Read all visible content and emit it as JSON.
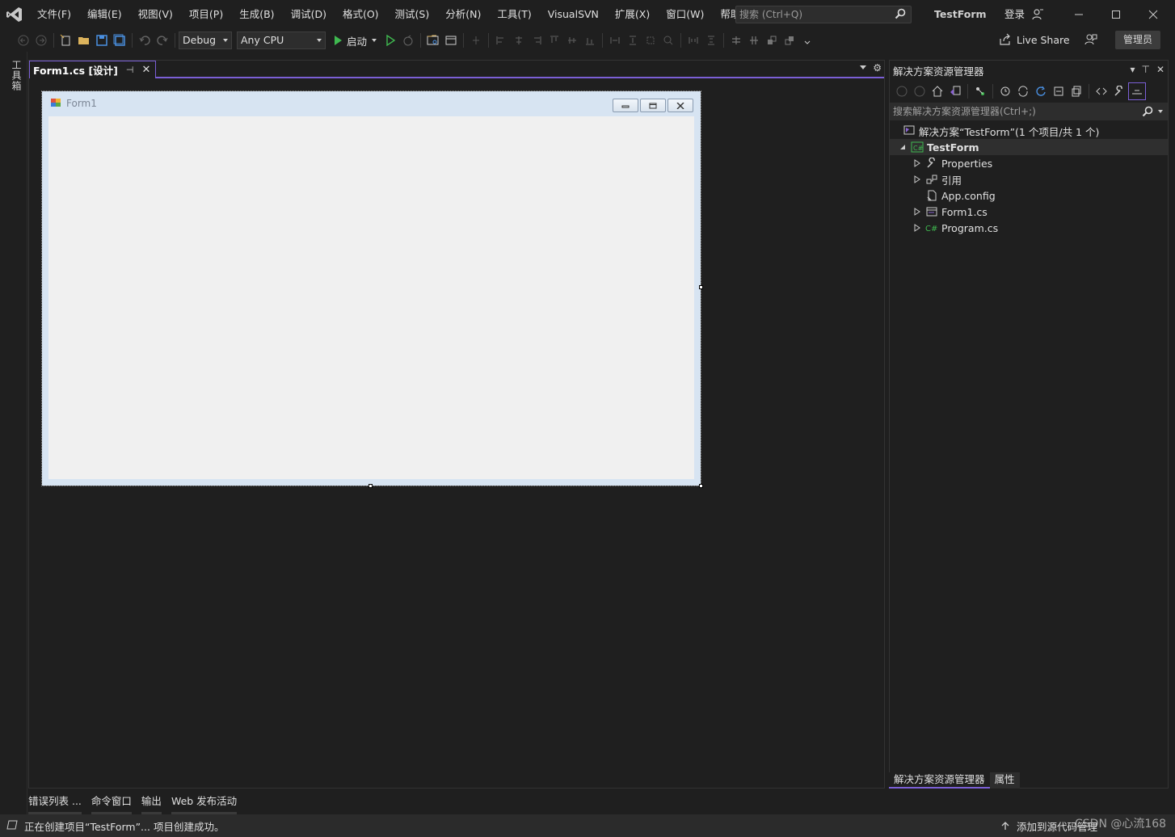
{
  "titlebar": {
    "menu": [
      "文件(F)",
      "编辑(E)",
      "视图(V)",
      "项目(P)",
      "生成(B)",
      "调试(D)",
      "格式(O)",
      "测试(S)",
      "分析(N)",
      "工具(T)",
      "VisualSVN",
      "扩展(X)",
      "窗口(W)",
      "帮助(H)"
    ],
    "search_placeholder": "搜索 (Ctrl+Q)",
    "solution_name": "TestForm",
    "login": "登录"
  },
  "toolbar": {
    "config": "Debug",
    "platform": "Any CPU",
    "start_label": "启动",
    "live_share": "Live Share",
    "admin": "管理员"
  },
  "toolbox": {
    "label": "工具箱"
  },
  "document": {
    "tab_label": "Form1.cs [设计]",
    "form_title": "Form1"
  },
  "bottom_tabs": [
    "错误列表 ...",
    "命令窗口",
    "输出",
    "Web 发布活动"
  ],
  "solution_explorer": {
    "title": "解决方案资源管理器",
    "search_placeholder": "搜索解决方案资源管理器(Ctrl+;)",
    "solution_label": "解决方案“TestForm”(1 个项目/共 1 个)",
    "project": "TestForm",
    "items": [
      {
        "label": "Properties",
        "icon": "wrench-icon",
        "expandable": true
      },
      {
        "label": "引用",
        "icon": "references-icon",
        "expandable": true
      },
      {
        "label": "App.config",
        "icon": "config-file-icon",
        "expandable": false
      },
      {
        "label": "Form1.cs",
        "icon": "form-file-icon",
        "expandable": true
      },
      {
        "label": "Program.cs",
        "icon": "csharp-file-icon",
        "expandable": true
      }
    ],
    "tabs": [
      "解决方案资源管理器",
      "属性"
    ]
  },
  "statusbar": {
    "message": "正在创建项目“TestForm”... 项目创建成功。",
    "source_control": "添加到源代码管理"
  },
  "watermark": "CSDN @心流168",
  "colors": {
    "accent": "#7b5fd6",
    "background": "#1f1f1f",
    "form_client": "#f0f0f0",
    "form_frame": "#d7e4f2"
  }
}
